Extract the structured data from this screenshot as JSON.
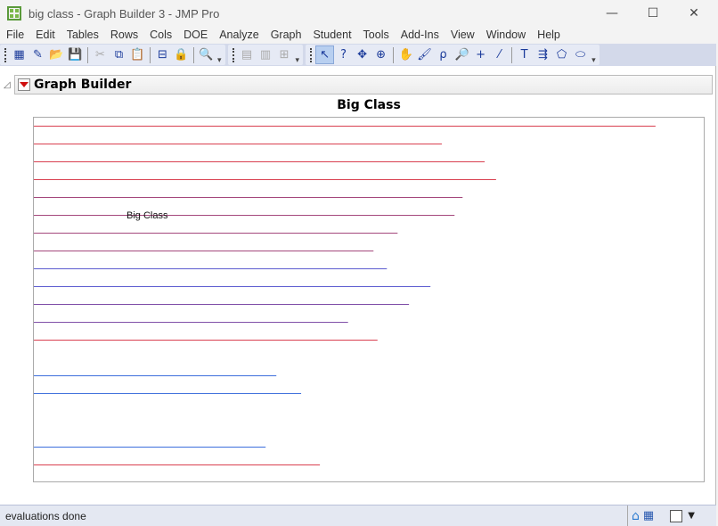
{
  "window": {
    "title": "big class - Graph Builder 3 - JMP Pro",
    "controls": [
      "minimize",
      "maximize",
      "close"
    ]
  },
  "menu": [
    "File",
    "Edit",
    "Tables",
    "Rows",
    "Cols",
    "DOE",
    "Analyze",
    "Graph",
    "Student",
    "Tools",
    "Add-Ins",
    "View",
    "Window",
    "Help"
  ],
  "toolbar": {
    "groups": [
      [
        {
          "icon": "new-data-table-icon",
          "glyph": "▦"
        },
        {
          "icon": "new-script-icon",
          "glyph": "✎"
        },
        {
          "icon": "open-folder-icon",
          "glyph": "📂"
        },
        {
          "icon": "save-icon",
          "glyph": "💾"
        },
        {
          "sep": true
        },
        {
          "icon": "cut-icon",
          "glyph": "✂",
          "disabled": true
        },
        {
          "icon": "copy-icon",
          "glyph": "⧉"
        },
        {
          "icon": "paste-icon",
          "glyph": "📋"
        },
        {
          "sep": true
        },
        {
          "icon": "toggle-settings-icon",
          "glyph": "⊟"
        },
        {
          "icon": "lock-icon",
          "glyph": "🔒",
          "disabled": true
        },
        {
          "sep": true
        },
        {
          "icon": "search-icon",
          "glyph": "🔍"
        }
      ],
      [
        {
          "icon": "data-table-icon",
          "glyph": "▤",
          "disabled": true
        },
        {
          "icon": "columns-icon",
          "glyph": "▥",
          "disabled": true
        },
        {
          "icon": "add-table-icon",
          "glyph": "⊞",
          "disabled": true
        }
      ],
      [
        {
          "icon": "arrow-pointer-icon",
          "glyph": "↖",
          "selected": true
        },
        {
          "icon": "help-icon",
          "glyph": "?"
        },
        {
          "icon": "crosshair-move-icon",
          "glyph": "✥"
        },
        {
          "icon": "target-icon",
          "glyph": "⊕"
        },
        {
          "sep": true
        },
        {
          "icon": "hand-grabber-icon",
          "glyph": "✋"
        },
        {
          "icon": "brush-icon",
          "glyph": "🖌"
        },
        {
          "icon": "lasso-icon",
          "glyph": "ρ"
        },
        {
          "icon": "magnifier-icon",
          "glyph": "🔎"
        },
        {
          "icon": "crosshair-icon",
          "glyph": "+"
        },
        {
          "icon": "ruler-icon",
          "glyph": "⁄"
        },
        {
          "sep": true
        },
        {
          "icon": "annotate-text-icon",
          "glyph": "T"
        },
        {
          "icon": "line-arrow-icon",
          "glyph": "⇶"
        },
        {
          "icon": "polygon-icon",
          "glyph": "⬠"
        },
        {
          "icon": "ellipse-icon",
          "glyph": "⬭"
        }
      ]
    ]
  },
  "outline": {
    "title": "Graph Builder"
  },
  "chart_data": {
    "type": "bar",
    "title": "Big Class",
    "annotation": "Big Class",
    "orientation": "horizontal-lines",
    "xlim": [
      0,
      100
    ],
    "grid": false,
    "rows": [
      0,
      1,
      2,
      3,
      4,
      5,
      6,
      7,
      8,
      9,
      10,
      11,
      12,
      14,
      15,
      18,
      19
    ],
    "values": [
      92.8,
      60.9,
      67.3,
      69.0,
      64.0,
      62.8,
      54.3,
      50.7,
      52.7,
      59.2,
      56.0,
      46.9,
      51.3,
      36.2,
      39.9,
      34.6,
      42.7
    ],
    "colors": [
      "#d94050",
      "#d94050",
      "#d94050",
      "#d94050",
      "#a4487c",
      "#a4487c",
      "#a4487c",
      "#a4487c",
      "#5c5cd0",
      "#5c5cd0",
      "#8050a8",
      "#8050a8",
      "#d94050",
      "#3d6fdc",
      "#3d6fdc",
      "#3d6fdc",
      "#d94050"
    ]
  },
  "status": {
    "text": "evaluations done",
    "icons": [
      "home-icon",
      "data-grid-icon",
      "selection-box-icon",
      "dropdown-arrow-icon"
    ]
  }
}
